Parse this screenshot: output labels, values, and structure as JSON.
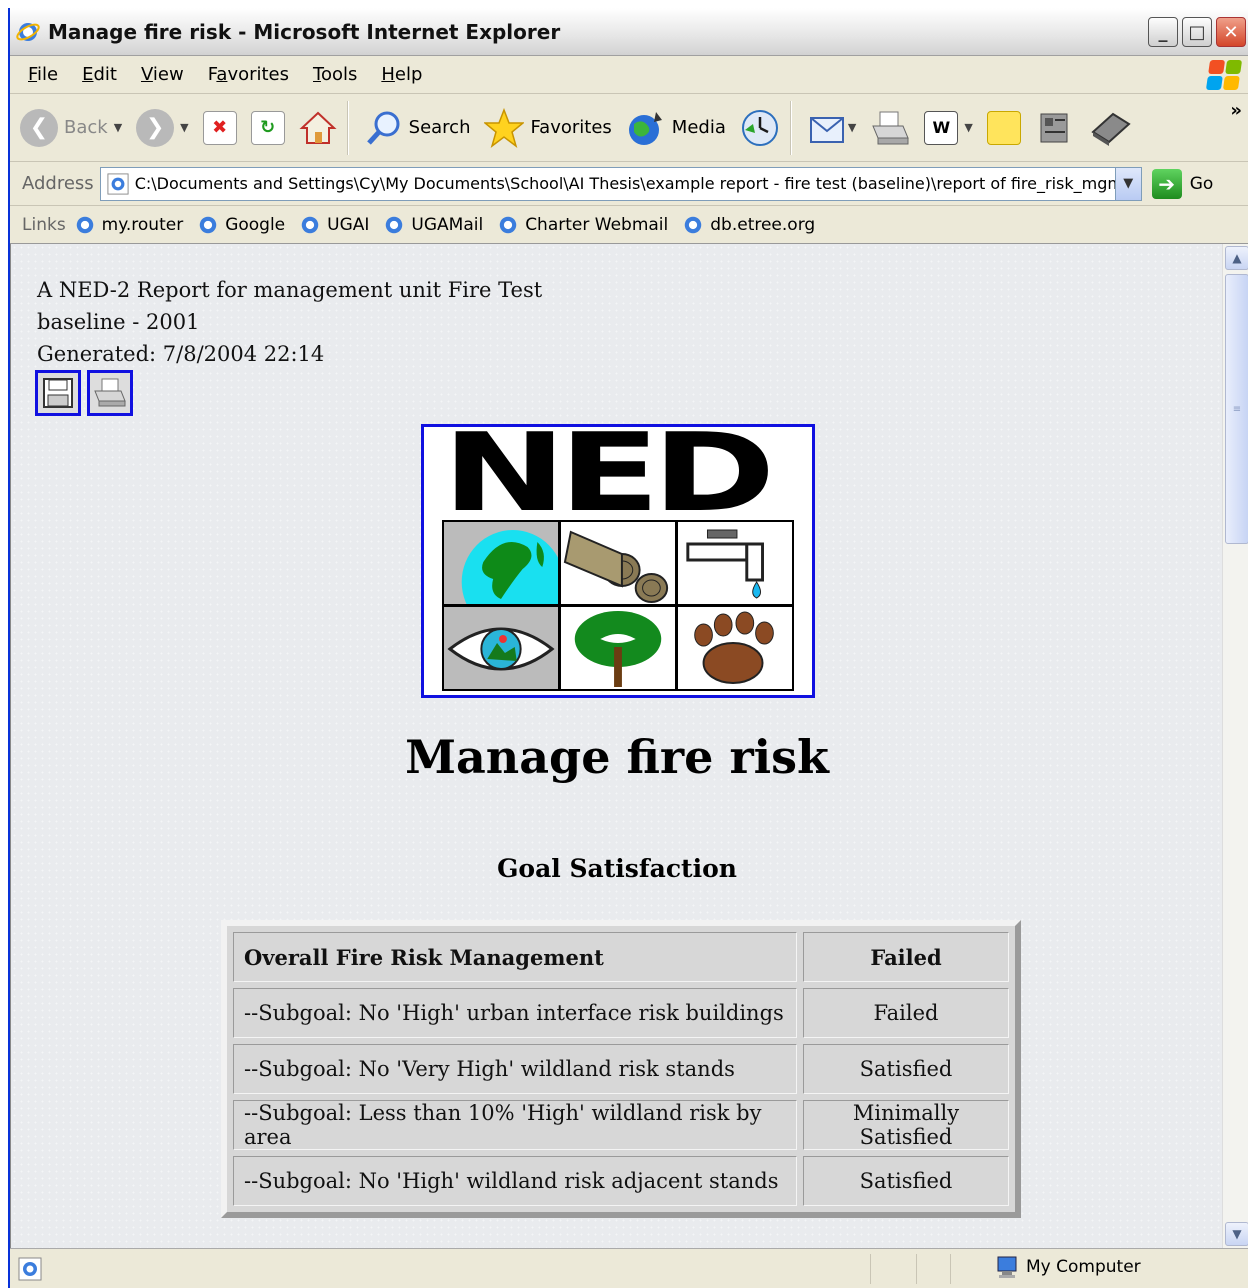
{
  "window": {
    "title": "Manage fire risk - Microsoft Internet Explorer"
  },
  "menu": [
    {
      "label": "File",
      "u": "F",
      "rest": "ile"
    },
    {
      "label": "Edit",
      "u": "E",
      "rest": "dit"
    },
    {
      "label": "View",
      "u": "V",
      "rest": "iew"
    },
    {
      "label": "Favorites",
      "pre": "F",
      "u": "a",
      "rest": "vorites"
    },
    {
      "label": "Tools",
      "u": "T",
      "rest": "ools"
    },
    {
      "label": "Help",
      "u": "H",
      "rest": "elp"
    }
  ],
  "toolbar": {
    "back": "Back",
    "search": "Search",
    "favorites": "Favorites",
    "media": "Media",
    "more": "»"
  },
  "address": {
    "label": "Address",
    "value": "C:\\Documents and Settings\\Cy\\My Documents\\School\\AI Thesis\\example report - fire test (baseline)\\report of fire_risk_mgm",
    "go": "Go"
  },
  "links": {
    "label": "Links",
    "items": [
      "my.router",
      "Google",
      "UGAI",
      "UGAMail",
      "Charter Webmail",
      "db.etree.org"
    ]
  },
  "report": {
    "line1": "A NED-2 Report for management unit Fire Test",
    "line2": "baseline - 2001",
    "line3": "Generated: 7/8/2004 22:14",
    "logo_text": "NED",
    "title": "Manage fire risk",
    "goal_heading": "Goal Satisfaction",
    "goals": [
      {
        "name": "Overall Fire Risk Management",
        "status": "Failed"
      },
      {
        "name": "--Subgoal: No 'High' urban interface risk buildings",
        "status": "Failed"
      },
      {
        "name": "--Subgoal: No 'Very High' wildland risk stands",
        "status": "Satisfied"
      },
      {
        "name": "--Subgoal: Less than 10% 'High' wildland risk by area",
        "status": "Minimally Satisfied"
      },
      {
        "name": "--Subgoal: No 'High' wildland risk adjacent stands",
        "status": "Satisfied"
      }
    ]
  },
  "status": {
    "zone": "My Computer"
  }
}
